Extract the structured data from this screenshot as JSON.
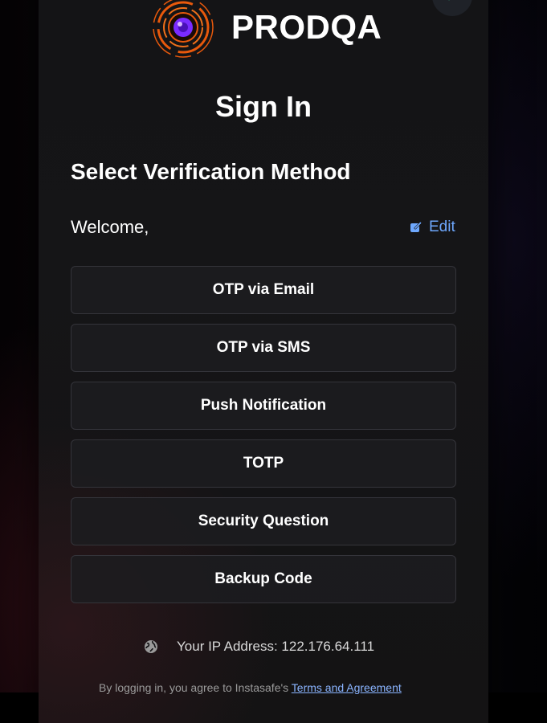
{
  "brand": {
    "name": "PRODQA",
    "logo_icon": "eye-orbit-logo"
  },
  "page": {
    "title": "Sign In"
  },
  "verification": {
    "heading": "Select Verification Method",
    "welcome": "Welcome,",
    "edit_label": "Edit",
    "edit_icon": "edit-icon",
    "methods": [
      {
        "label": "OTP via Email"
      },
      {
        "label": "OTP via SMS"
      },
      {
        "label": "Push Notification"
      },
      {
        "label": "TOTP"
      },
      {
        "label": "Security Question"
      },
      {
        "label": "Backup Code"
      }
    ]
  },
  "footer": {
    "ip_icon": "globe-icon",
    "ip_text": "Your IP Address: 122.176.64.111",
    "terms_prefix": "By logging in, you agree to Instasafe's ",
    "terms_link": "Terms and Agreement"
  },
  "colors": {
    "accent_link": "#6ea8fe",
    "logo_orange": "#e8590c",
    "logo_purple": "#8b3dff",
    "button_border": "#34343a"
  }
}
